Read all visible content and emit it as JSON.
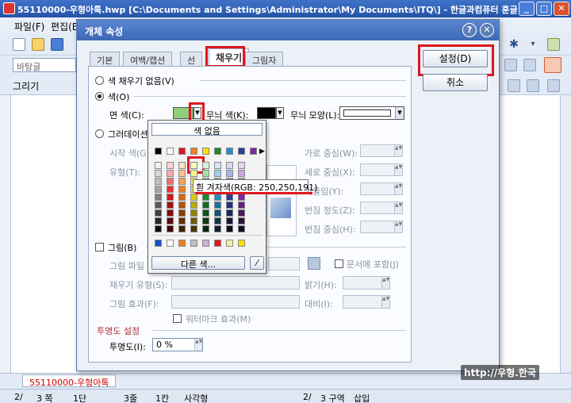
{
  "window": {
    "title": "55110000-우형아톡.hwp [C:\\Documents and Settings\\Administrator\\My Documents\\ITQ\\] - 한글과컴퓨터 훈글",
    "minimize": "_",
    "maximize": "□",
    "close": "✕"
  },
  "menu": {
    "file": "파일(F)",
    "edit": "편집(E)"
  },
  "toolbar": {
    "style_name": "바탕글",
    "draw": "그리기"
  },
  "dialog": {
    "title": "개체 속성",
    "help_icon": "?",
    "close_icon": "✕",
    "tabs": [
      "기본",
      "여백/캡션",
      "선",
      "채우기",
      "그림자"
    ],
    "active_tab": "채우기",
    "ok_button": "설정(D)",
    "cancel_button": "취소",
    "fill": {
      "no_fill": "색 채우기 없음(V)",
      "color": "색(O)",
      "face_color_label": "면 색(C):",
      "face_color_value": "#8fce7a",
      "pattern_color_label": "무늬 색(K):",
      "pattern_color_value": "#000000",
      "pattern_shape_label": "무늬 모양(L):",
      "gradation": "그러데이션",
      "start_color": "시작 색(G",
      "type": "유형(T):",
      "h_center": "가로 중심(W):",
      "v_center": "세로 중심(X):",
      "tilt": "기울임(Y):",
      "blur_degree": "번짐 정도(Z):",
      "blur_center": "번짐 중심(H):",
      "picture": "그림(B)",
      "picture_file": "그림 파일",
      "in_document": "문서에 포함(J)",
      "fill_type": "채우기 유형(S):",
      "picture_effect": "그림 효과(F):",
      "brightness": "밝기(H):",
      "contrast": "대비(I):",
      "watermark_effect": "워터마크 효과(M)",
      "transparency_heading": "투명도 설정",
      "transparency_label": "투명도(I):",
      "transparency_value": "0 %"
    }
  },
  "palette": {
    "no_color": "색 없음",
    "more_colors": "다른 색...",
    "eyedropper": "⁄",
    "tooltip": "흰 겨자색(RGB: 250,250,191)",
    "top_row": [
      "#000000",
      "#ffffff",
      "#e0161d",
      "#f08020",
      "#ffe000",
      "#1a8a2a",
      "#1f8fc8",
      "#2a3f9f",
      "#7a2a9a"
    ],
    "columns": [
      [
        "#f2f2f2",
        "#d8d8d8",
        "#bfbfbf",
        "#a5a5a5",
        "#7f7f7f",
        "#595959",
        "#3f3f3f",
        "#262626",
        "#0c0c0c"
      ],
      [
        "#fbd4d4",
        "#f7a9a9",
        "#f07070",
        "#e83030",
        "#d01818",
        "#a81010",
        "#800c0c",
        "#600808",
        "#400404"
      ],
      [
        "#fde0c8",
        "#fbc090",
        "#f8a058",
        "#f08020",
        "#d86810",
        "#b05408",
        "#884006",
        "#603004",
        "#402002"
      ],
      [
        "#fafabf",
        "#f5f58a",
        "#f0ee60",
        "#ece040",
        "#dccc10",
        "#b8aa08",
        "#908406",
        "#685e04",
        "#403a02"
      ],
      [
        "#d4f0d4",
        "#a8e0a8",
        "#70c870",
        "#40b040",
        "#1a8a2a",
        "#146e20",
        "#105418",
        "#0c3c10",
        "#082808"
      ],
      [
        "#d0e8f8",
        "#a0d0f0",
        "#68b8e8",
        "#3898d8",
        "#1f8fc8",
        "#1870a0",
        "#125478",
        "#0c3850",
        "#082030"
      ],
      [
        "#d4daf4",
        "#a8b4e8",
        "#7888d8",
        "#4a60c0",
        "#2a3f9f",
        "#22327e",
        "#1a265e",
        "#121a3e",
        "#0a0e20"
      ],
      [
        "#e6d4f0",
        "#cca8e0",
        "#b080cc",
        "#9450b8",
        "#7a2a9a",
        "#60207a",
        "#48185a",
        "#30103c",
        "#180820"
      ]
    ],
    "recent_row": [
      "#1a4fc8",
      "#ffffff",
      "#f08020",
      "#c0c0c0",
      "#c8b0d8",
      "#e0161d",
      "#f5f0a0",
      "#ffe000"
    ]
  },
  "tabbar": {
    "document": "55110000-우형아톡"
  },
  "statusbar": {
    "page": "2/",
    "pages": "3 쪽",
    "section": "1단",
    "line": "3줄",
    "column": "1칸",
    "object": "사각형",
    "section_count": "2/",
    "zone": "3 구역",
    "insert_mode": "삽입"
  },
  "watermark": "http://우형.한국"
}
